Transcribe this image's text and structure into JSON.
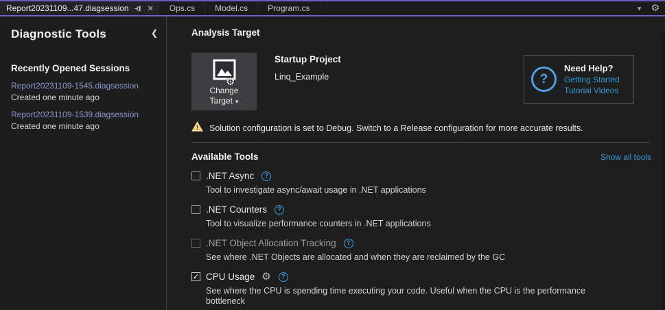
{
  "colors": {
    "accent_purple": "#6c5ec9",
    "link_blue": "#379ad6",
    "session_link_blue": "#8d99d4",
    "warning_yellow": "#f3cf75"
  },
  "icons": {
    "close": "✕",
    "chevron_down": "▾",
    "gear": "⚙",
    "collapse_left": "❮",
    "dropdown_caret": "▼",
    "question": "?",
    "check": "✓",
    "warning_mark": "!"
  },
  "tab_bar": {
    "active_tab": "Report20231109...47.diagsession",
    "tabs": [
      "Ops.cs",
      "Model.cs",
      "Program.cs"
    ]
  },
  "sidebar": {
    "title": "Diagnostic Tools",
    "sessions_heading": "Recently Opened Sessions",
    "sessions": [
      {
        "name": "Report20231109-1545.diagsession",
        "created": "Created one minute ago"
      },
      {
        "name": "Report20231109-1539.diagsession",
        "created": "Created one minute ago"
      }
    ]
  },
  "main": {
    "analysis_target_heading": "Analysis Target",
    "change_target": {
      "line1": "Change",
      "line2": "Target"
    },
    "startup_project_title": "Startup Project",
    "startup_project_name": "Linq_Example",
    "need_help": {
      "title": "Need Help?",
      "link1": "Getting Started",
      "link2": "Tutorial Videos"
    },
    "warning_text": "Solution configuration is set to Debug. Switch to a Release configuration for more accurate results.",
    "available_tools_heading": "Available Tools",
    "show_all_tools": "Show all tools",
    "tools": [
      {
        "label": ".NET Async",
        "checked": false,
        "disabled": false,
        "has_gear": false,
        "description": "Tool to investigate async/await usage in .NET applications"
      },
      {
        "label": ".NET Counters",
        "checked": false,
        "disabled": false,
        "has_gear": false,
        "description": "Tool to visualize performance counters in .NET applications"
      },
      {
        "label": ".NET Object Allocation Tracking",
        "checked": false,
        "disabled": true,
        "has_gear": false,
        "description": "See where .NET Objects are allocated and when they are reclaimed by the GC"
      },
      {
        "label": "CPU Usage",
        "checked": true,
        "disabled": false,
        "has_gear": true,
        "description": "See where the CPU is spending time executing your code. Useful when the CPU is the performance bottleneck"
      }
    ]
  }
}
